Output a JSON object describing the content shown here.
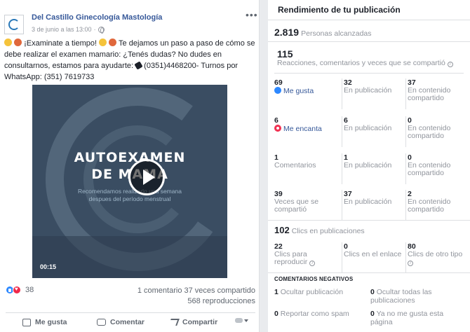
{
  "post": {
    "page_name": "Del Castillo Ginecología Mastología",
    "date": "3 de junio a las 13:00",
    "text_parts": {
      "intro": "¡Examinate a tiempo!",
      "body": " Te dejamos un paso a paso de cómo se debe realizar el examen mamario: ¿Tenés dudas? No dudes en consultarnos, estamos para ayudarte: ",
      "phone_tail": " (0351)4468200- Turnos por WhatsApp: (351) 7619733"
    },
    "video": {
      "title_line1": "AUTOEXAMEN",
      "title_line2": "DE MAMA",
      "subtitle_line1": "Recomendamos realizarlo una semana",
      "subtitle_line2": "despues del período menstrual",
      "time": "00:15"
    },
    "reactions_count": "38",
    "stats": {
      "comments": "1 comentario",
      "shares": "37 veces compartido",
      "views": "568 reproducciones"
    },
    "actions": {
      "like": "Me gusta",
      "comment": "Comentar",
      "share": "Compartir"
    }
  },
  "insights": {
    "title": "Rendimiento de tu publicación",
    "reach": {
      "value": "2.819",
      "label": "Personas alcanzadas"
    },
    "reactions_total": {
      "value": "115",
      "label": "Reacciones, comentarios y veces que se compartió"
    },
    "rows": [
      {
        "main": {
          "n": "69",
          "t": "Me gusta"
        },
        "pub": {
          "n": "32",
          "t": "En publicación"
        },
        "shared": {
          "n": "37",
          "t": "En contenido compartido"
        }
      },
      {
        "main": {
          "n": "6",
          "t": "Me encanta"
        },
        "pub": {
          "n": "6",
          "t": "En publicación"
        },
        "shared": {
          "n": "0",
          "t": "En contenido compartido"
        }
      },
      {
        "main": {
          "n": "1",
          "t": "Comentarios"
        },
        "pub": {
          "n": "1",
          "t": "En publicación"
        },
        "shared": {
          "n": "0",
          "t": "En contenido compartido"
        }
      },
      {
        "main": {
          "n": "39",
          "t": "Veces que se compartió"
        },
        "pub": {
          "n": "37",
          "t": "En publicación"
        },
        "shared": {
          "n": "2",
          "t": "En contenido compartido"
        }
      }
    ],
    "clicks": {
      "value": "102",
      "label": "Clics en publicaciones",
      "play": {
        "n": "22",
        "t": "Clics para reproducir"
      },
      "link": {
        "n": "0",
        "t": "Clics en el enlace"
      },
      "other": {
        "n": "80",
        "t": "Clics de otro tipo"
      }
    },
    "negative": {
      "heading": "COMENTARIOS NEGATIVOS",
      "hide_post": {
        "n": "1",
        "t": "Ocultar publicación"
      },
      "hide_all": {
        "n": "0",
        "t": "Ocultar todas las publicaciones"
      },
      "spam": {
        "n": "0",
        "t": "Reportar como spam"
      },
      "unlike": {
        "n": "0",
        "t": "Ya no me gusta esta página"
      }
    }
  },
  "colors": {
    "link_blue": "#365899",
    "like_blue": "#2d88ff",
    "love_red": "#f0284a",
    "video_bg": "#3a4d62"
  }
}
